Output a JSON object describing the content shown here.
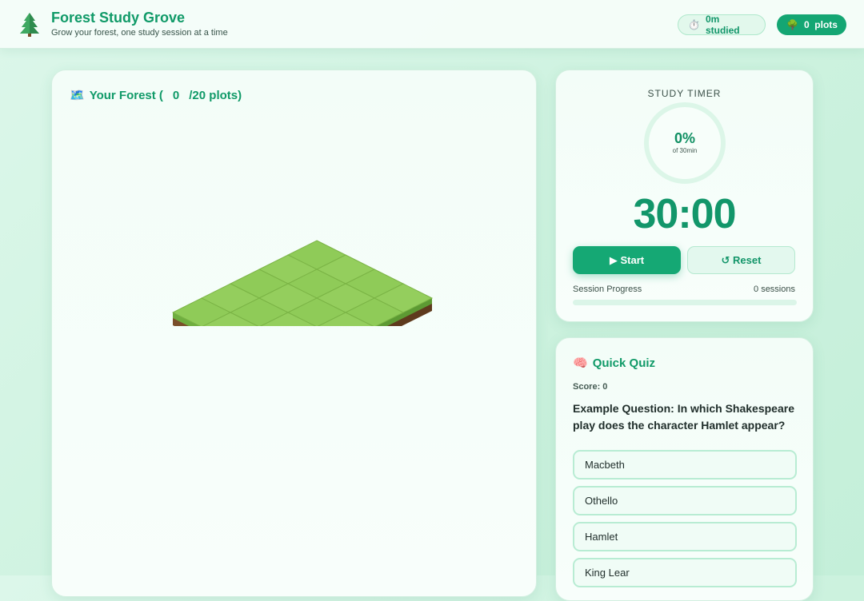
{
  "header": {
    "title": "Forest Study Grove",
    "subtitle": "Grow your forest, one study session at a time",
    "studied_icon": "⏱️",
    "studied_text": "0m studied",
    "plots_icon": "🌳",
    "plots_text": "0  plots"
  },
  "forest": {
    "title_icon": "🗺️",
    "title_prefix": "Your Forest (",
    "planted_count": "0",
    "title_suffix": "/20 plots)",
    "grid_columns": 4,
    "grid_rows": 5
  },
  "timer": {
    "label": "STUDY TIMER",
    "percent_text": "0%",
    "percent_value": 0,
    "percent_caption": "of 30min",
    "clock": "30:00",
    "start_label": "▶ Start",
    "reset_label": "↺ Reset",
    "progress_label": "Session Progress",
    "sessions_text": "0 sessions",
    "progress_value": 0
  },
  "quiz": {
    "title_icon": "🧠",
    "title": "Quick Quiz",
    "score_text": "Score: 0",
    "question": "Example Question: In which Shakespeare play does the character Hamlet appear?",
    "options": [
      "Macbeth",
      "Othello",
      "Hamlet",
      "King Lear"
    ]
  },
  "colors": {
    "accent": "#15a874",
    "accent_dark": "#109a68",
    "grass": "#8dc955",
    "soil": "#7a4f2a"
  }
}
